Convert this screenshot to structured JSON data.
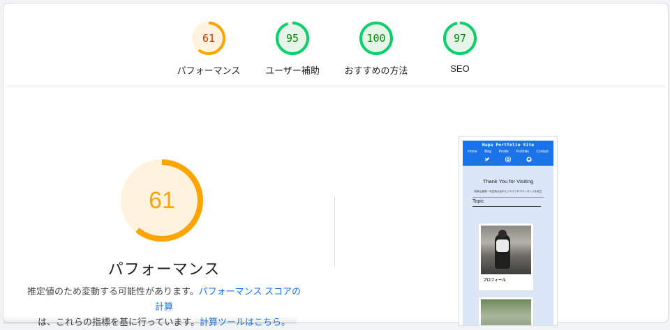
{
  "gauges": [
    {
      "score": "61",
      "label": "パフォーマンス",
      "fraction": 0.61,
      "color": "#ffa400",
      "fill": "#fff3e0",
      "text_color": "#c33300"
    },
    {
      "score": "95",
      "label": "ユーザー補助",
      "fraction": 0.95,
      "color": "#0cce6b",
      "fill": "#e6f4ea",
      "text_color": "#008800"
    },
    {
      "score": "100",
      "label": "おすすめの方法",
      "fraction": 1.0,
      "color": "#0cce6b",
      "fill": "#e6f4ea",
      "text_color": "#008800"
    },
    {
      "score": "97",
      "label": "SEO",
      "fraction": 0.97,
      "color": "#0cce6b",
      "fill": "#e6f4ea",
      "text_color": "#008800"
    }
  ],
  "performance": {
    "score": "61",
    "fraction": 0.61,
    "title": "パフォーマンス",
    "desc_part1": "推定値のため変動する可能性があります。",
    "link1": "パフォーマンス スコアの計算",
    "desc_part2": "は、これらの指標を基に行っています。",
    "link2": "計算ツールはこちら。"
  },
  "preview": {
    "site_title": "Napa Portfolio Site",
    "nav": [
      "Home",
      "Blog",
      "Profile",
      "Portfolio",
      "Contact"
    ],
    "icons": [
      "twitter-icon",
      "instagram-icon",
      "github-icon"
    ],
    "heading": "Thank You for Visiting",
    "intro": "岐阜出身高一年生時大会中ビジネスブログセンタンスを設立",
    "topic": "Topic",
    "card1_caption": "プロフィール"
  }
}
